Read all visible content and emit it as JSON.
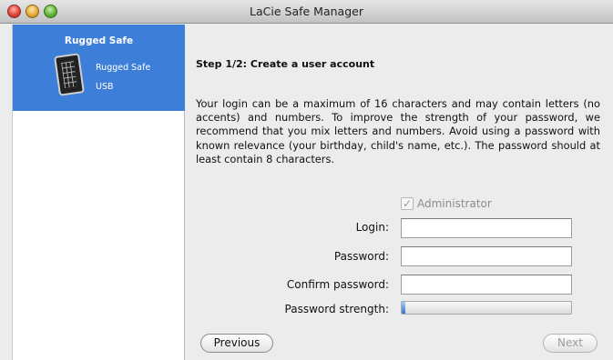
{
  "window": {
    "title": "LaCie Safe Manager"
  },
  "sidebar": {
    "heading": "Rugged Safe",
    "device": {
      "name": "Rugged Safe",
      "type": "USB"
    }
  },
  "main": {
    "step_title": "Step 1/2: Create a user account",
    "description": "Your login can be a maximum of 16 characters and may contain letters (no accents) and numbers. To improve the strength of your password, we recommend that you mix letters and numbers. Avoid using a password with known relevance (your birthday, child's name, etc.). The password should at least contain 8 characters.",
    "administrator": {
      "label": "Administrator",
      "checked": true,
      "enabled": false
    },
    "form": {
      "login_label": "Login:",
      "login_value": "",
      "password_label": "Password:",
      "password_value": "",
      "confirm_label": "Confirm password:",
      "confirm_value": "",
      "strength_label": "Password strength:",
      "strength_fraction": 0.02
    },
    "buttons": {
      "previous": "Previous",
      "next": "Next"
    }
  },
  "colors": {
    "sidebar_selection": "#3d7fd8",
    "strength_fill": "#2f76d6"
  }
}
